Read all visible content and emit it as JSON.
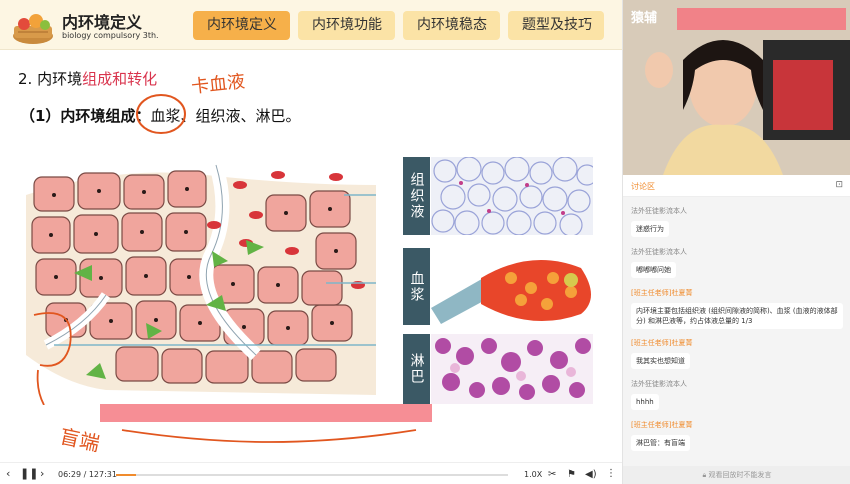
{
  "header": {
    "title": "内环境定义",
    "subtitle": "biology compulsory 3th.",
    "tabs": [
      {
        "label": "内环境定义",
        "active": true
      },
      {
        "label": "内环境功能",
        "active": false
      },
      {
        "label": "内环境稳态",
        "active": false
      },
      {
        "label": "题型及技巧",
        "active": false
      }
    ]
  },
  "slide": {
    "heading_prefix": "2. 内环境",
    "heading_highlight": "组成和转化",
    "sub_prefix": "（1）内环境组成：",
    "sub_items": "血浆、组织液、淋巴。",
    "handwrite_top": "卡血液",
    "handwrite_bottom": "盲端",
    "labels": [
      "组织液",
      "血浆",
      "淋巴"
    ]
  },
  "player": {
    "time": "06:29 / 127:31",
    "progress_fraction": 0.051,
    "speed": "1.0X"
  },
  "panel": {
    "video_brand": "猿辅",
    "chat_title": "讨论区",
    "messages": [
      {
        "author": "法外狂徒影流本人",
        "role": "student",
        "text": "迷惑行为"
      },
      {
        "author": "法外狂徒影流本人",
        "role": "student",
        "text": "嘟嘟嘟问她"
      },
      {
        "author": "[班主任老师]杜夏菁",
        "role": "teacher",
        "text": "内环境主要包括组织液 (组织间隙液的简称)、血浆 (血液的液体部分) 和淋巴液等，约占体液总量的 1/3"
      },
      {
        "author": "[班主任老师]杜夏菁",
        "role": "teacher",
        "text": "我其实也想知道"
      },
      {
        "author": "法外狂徒影流本人",
        "role": "student",
        "text": "hhhh"
      },
      {
        "author": "[班主任老师]杜夏菁",
        "role": "teacher",
        "text": "淋巴管：有盲端"
      }
    ],
    "footer": "观看回放时不能发言"
  },
  "colors": {
    "accent": "#f08b2d",
    "tab_active": "#f6b04a",
    "tab_inactive": "#fbe3a6",
    "highlight_red": "#d9344d",
    "label_bg": "#3b5965"
  }
}
